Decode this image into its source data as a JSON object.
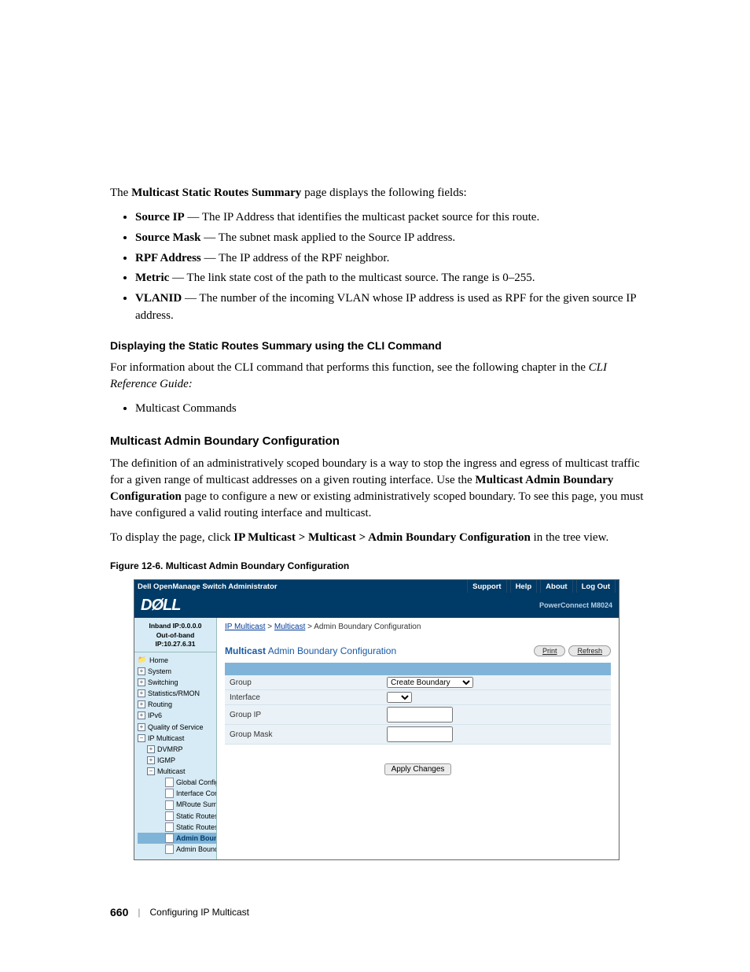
{
  "intro_line_pre": "The ",
  "intro_line_bold": "Multicast Static Routes Summary",
  "intro_line_post": " page displays the following fields:",
  "fields": [
    {
      "name": "Source IP",
      "desc": " — The IP Address that identifies the multicast packet source for this route."
    },
    {
      "name": "Source Mask",
      "desc": " — The subnet mask applied to the Source IP address."
    },
    {
      "name": "RPF Address",
      "desc": " — The IP address of the RPF neighbor."
    },
    {
      "name": "Metric",
      "desc": " — The link state cost of the path to the multicast source. The range is 0–255."
    },
    {
      "name": "VLANID",
      "desc": " — The number of the incoming VLAN whose IP address is used as RPF for the given source IP address."
    }
  ],
  "cli_heading": "Displaying the Static Routes Summary using the CLI Command",
  "cli_text_pre": "For information about the CLI command that performs this function, see the following chapter in the ",
  "cli_text_italic": "CLI Reference Guide:",
  "cli_bullet": "Multicast Commands",
  "section_heading": "Multicast Admin Boundary Configuration",
  "section_p1_pre": "The definition of an administratively scoped boundary is a way to stop the ingress and egress of multicast traffic for a given range of multicast addresses on a given routing interface. Use the ",
  "section_p1_bold": "Multicast Admin Boundary Configuration",
  "section_p1_post": " page to configure a new or existing administratively scoped boundary. To see this page, you must have configured a valid routing interface and multicast.",
  "section_p2_pre": "To display the page, click ",
  "section_p2_bold": "IP Multicast > Multicast > Admin Boundary Configuration",
  "section_p2_post": " in the tree view.",
  "figure_caption": "Figure 12-6.    Multicast Admin Boundary Configuration",
  "ui": {
    "title": "Dell OpenManage Switch Administrator",
    "toplinks": {
      "support": "Support",
      "help": "Help",
      "about": "About",
      "logout": "Log Out"
    },
    "logo": "DØLL",
    "model": "PowerConnect M8024",
    "inband": "Inband IP:0.0.0.0",
    "oob": "Out-of-band IP:10.27.6.31",
    "tree": {
      "home": "Home",
      "system": "System",
      "switching": "Switching",
      "stats": "Statistics/RMON",
      "routing": "Routing",
      "ipv6": "IPv6",
      "qos": "Quality of Service",
      "ipmc": "IP Multicast",
      "dvmrp": "DVMRP",
      "igmp": "IGMP",
      "multicast": "Multicast",
      "leaves": [
        "Global Configuration",
        "Interface Configuration",
        "MRoute Summary",
        "Static Routes Configu",
        "Static Routes Summa",
        "Admin Boundary Co",
        "Admin Boundary Sum"
      ]
    },
    "crumbs": {
      "a": "IP Multicast",
      "b": "Multicast",
      "c": "Admin Boundary Configuration"
    },
    "panel_title_bold": "Multicast",
    "panel_title_rest": " Admin Boundary Configuration",
    "btn_print": "Print",
    "btn_refresh": "Refresh",
    "form": {
      "group": "Group",
      "group_option": "Create Boundary",
      "interface": "Interface",
      "group_ip": "Group IP",
      "group_mask": "Group Mask"
    },
    "btn_apply": "Apply Changes"
  },
  "footer": {
    "page": "660",
    "chapter": "Configuring IP Multicast"
  }
}
